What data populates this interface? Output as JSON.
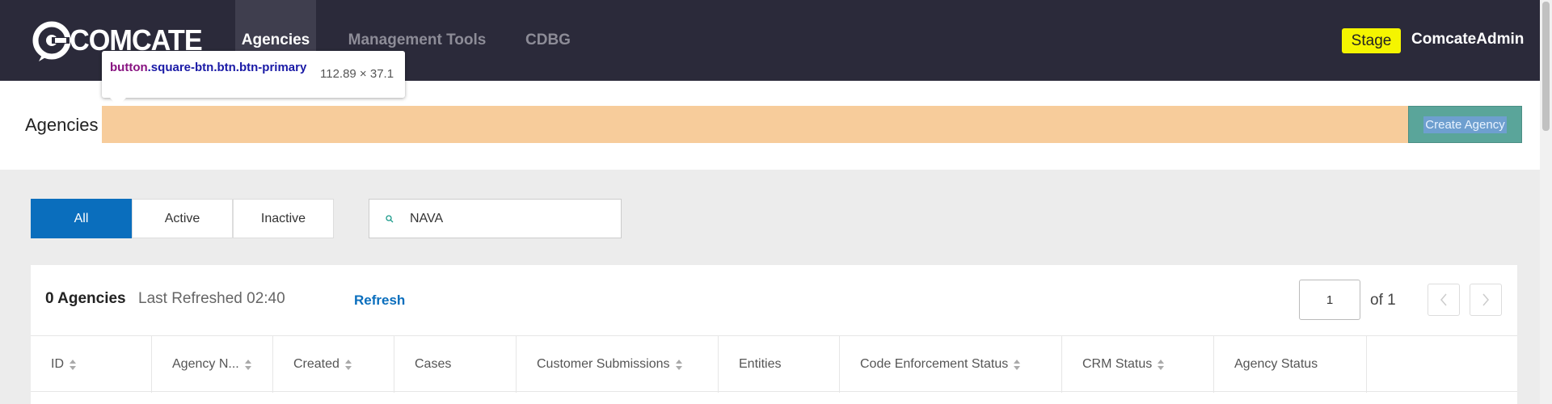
{
  "brand": {
    "name": "COMCATE"
  },
  "nav": {
    "items": [
      {
        "label": "Agencies",
        "active": true
      },
      {
        "label": "Management Tools",
        "active": false
      },
      {
        "label": "CDBG",
        "active": false
      }
    ],
    "environment_badge": "Stage",
    "user_name": "ComcateAdmin"
  },
  "tooltip": {
    "tag": "button",
    "classes": ".square-btn.btn.btn-primary",
    "size": "112.89 × 37.1"
  },
  "header": {
    "title": "Agencies",
    "create_button": "Create Agency"
  },
  "filters": {
    "segments": [
      {
        "label": "All",
        "active": true
      },
      {
        "label": "Active",
        "active": false
      },
      {
        "label": "Inactive",
        "active": false
      }
    ],
    "search_value": "NAVA"
  },
  "table": {
    "count_label": "0 Agencies",
    "last_refreshed": "Last Refreshed 02:40",
    "refresh_label": "Refresh",
    "current_page": "1",
    "page_total_label": "of 1",
    "columns": [
      {
        "label": "ID",
        "sortable": true
      },
      {
        "label": "Agency N...",
        "sortable": true
      },
      {
        "label": "Created",
        "sortable": true
      },
      {
        "label": "Cases",
        "sortable": false
      },
      {
        "label": "Customer Submissions",
        "sortable": true
      },
      {
        "label": "Entities",
        "sortable": false
      },
      {
        "label": "Code Enforcement Status",
        "sortable": true
      },
      {
        "label": "CRM Status",
        "sortable": true
      },
      {
        "label": "Agency Status",
        "sortable": false
      }
    ]
  },
  "colors": {
    "nav_bg": "#2b2a3a",
    "primary": "#0a6ebd",
    "badge": "#f5f500",
    "inspect_highlight": "#f7cc9b",
    "create_button": "#5aa59a"
  }
}
